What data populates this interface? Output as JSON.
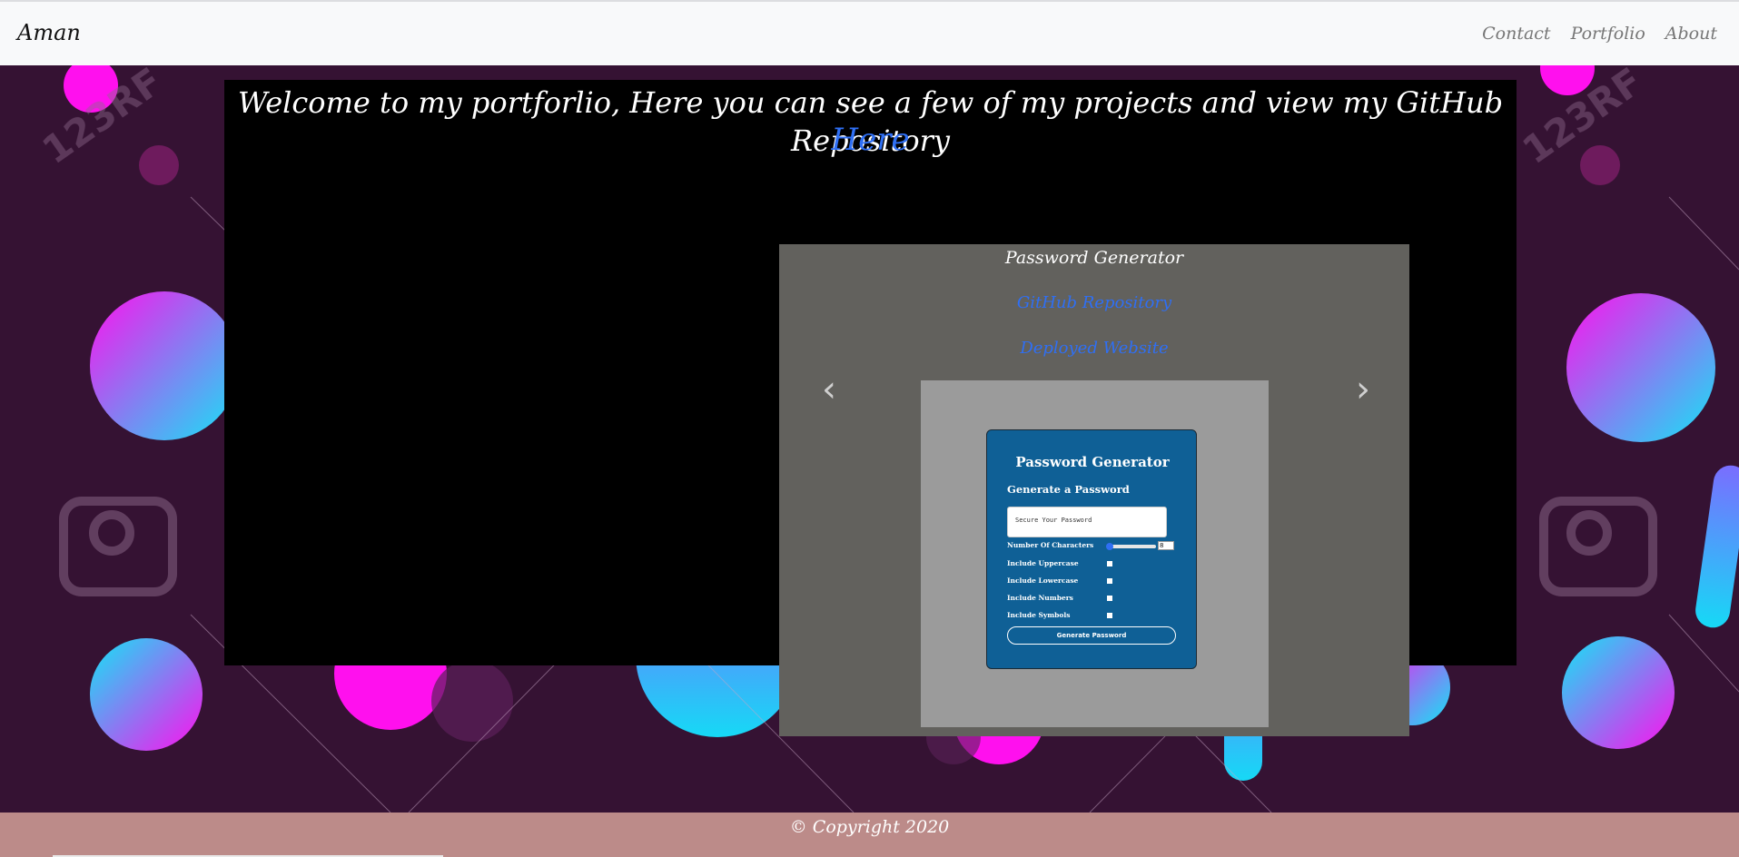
{
  "navbar": {
    "brand": "Aman",
    "links": [
      {
        "label": "Contact"
      },
      {
        "label": "Portfolio"
      },
      {
        "label": "About"
      }
    ]
  },
  "main": {
    "headline": "Welcome to my portforlio, Here you can see a few of my projects and view my GitHub Repository",
    "here_link": "Here"
  },
  "carousel": {
    "slide_title": "Password Generator",
    "github_link": "GitHub Repository",
    "deployed_link": "Deployed Website",
    "prev_icon": "‹",
    "next_icon": "›",
    "preview": {
      "title": "Password Generator",
      "subtitle": "Generate a Password",
      "placeholder": "Secure Your Password",
      "length_label": "Number Of Characters",
      "length_value": "8",
      "options": [
        {
          "label": "Include Uppercase"
        },
        {
          "label": "Include Lowercase"
        },
        {
          "label": "Include Numbers"
        },
        {
          "label": "Include Symbols"
        }
      ],
      "button_label": "Generate Password"
    }
  },
  "footer": {
    "text": "© Copyright 2020"
  },
  "colors": {
    "background": "#351233",
    "navbar": "#f8f9fa",
    "panel": "#000000",
    "carousel": "#62615d",
    "link": "#2f6ff4",
    "footer": "#bc8b89",
    "card": "#0f6096"
  }
}
